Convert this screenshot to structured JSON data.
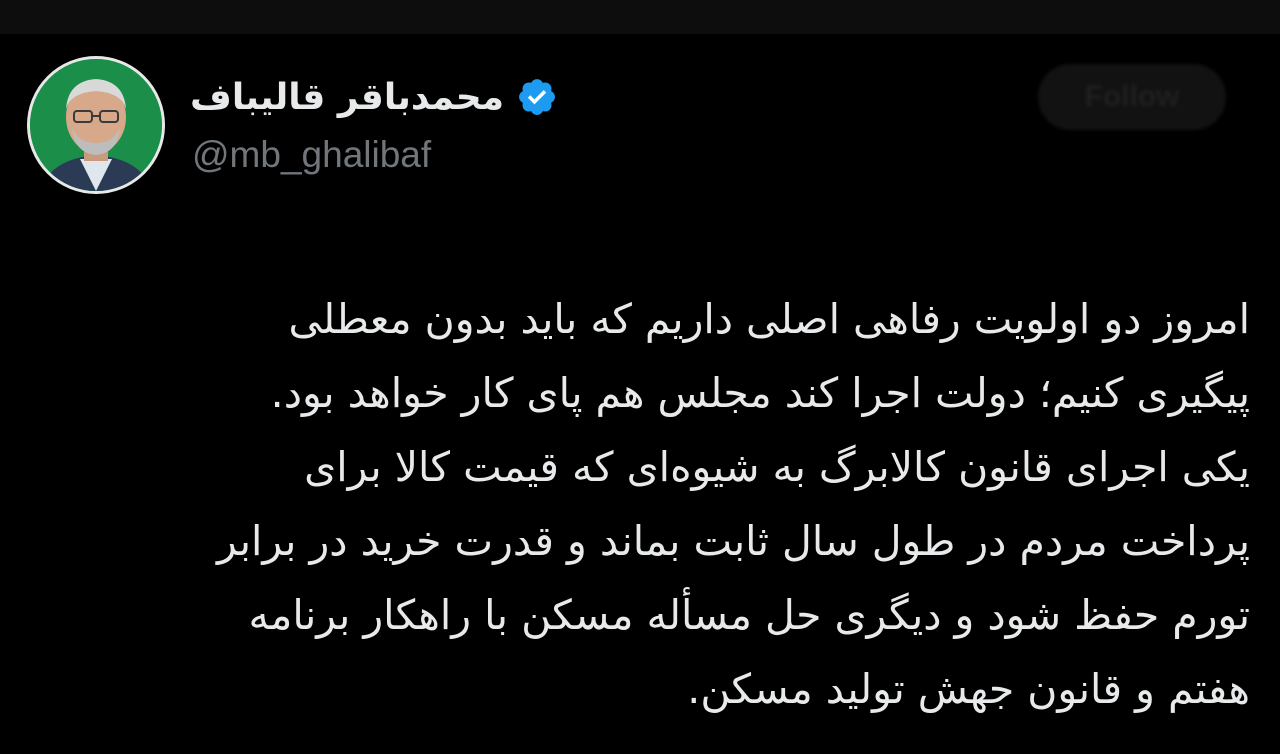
{
  "author": {
    "display_name": "محمدباقر قالیباف",
    "handle": "@mb_ghalibaf",
    "verified_icon": "verified-badge-icon",
    "verified_color": "#1d9bf0",
    "avatar_bg_color": "#1b8f4a"
  },
  "follow_button": {
    "label": "Follow"
  },
  "tweet": {
    "lines": [
      "امروز دو اولویت رفاهی اصلی داریم که باید بدون معطلی",
      "پیگیری کنیم؛ دولت اجرا کند مجلس هم پای کار خواهد بود.",
      "یکی اجرای قانون کالابرگ به شیوه‌ای که قیمت کالا برای",
      "پرداخت مردم در طول سال ثابت بماند و قدرت خرید در برابر",
      "تورم حفظ شود و دیگری حل مسأله مسکن با راهکار برنامه",
      "هفتم و قانون جهش تولید مسکن."
    ]
  }
}
